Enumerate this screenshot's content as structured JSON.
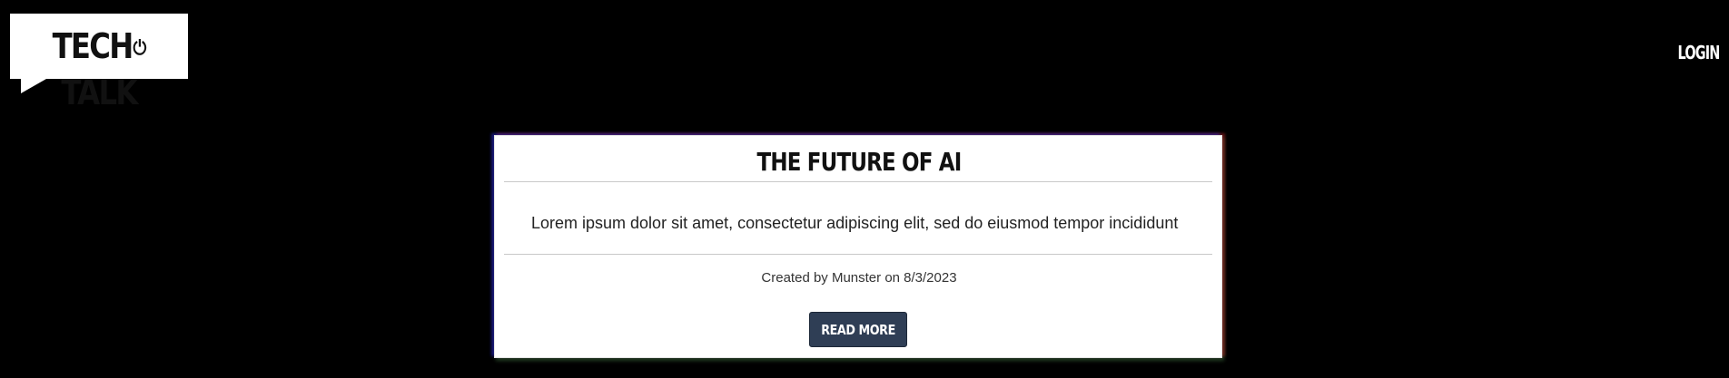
{
  "header": {
    "logo": {
      "text_left": "TECH",
      "text_right": "TALK",
      "power_icon": "power-icon"
    },
    "login_label": "LOGIN"
  },
  "post": {
    "title": "THE FUTURE OF AI",
    "excerpt": "Lorem ipsum dolor sit amet, consectetur adipiscing elit, sed do eiusmod tempor incididunt ut labore et dolore magna aliqua. Ut enim ad minim veniam, quis nostrud exercitation ullamco",
    "meta": "Created by Munster on 8/3/2023",
    "read_more_label": "READ MORE"
  },
  "colors": {
    "background": "#000000",
    "card": "#ffffff",
    "button": "#2f3e55"
  }
}
